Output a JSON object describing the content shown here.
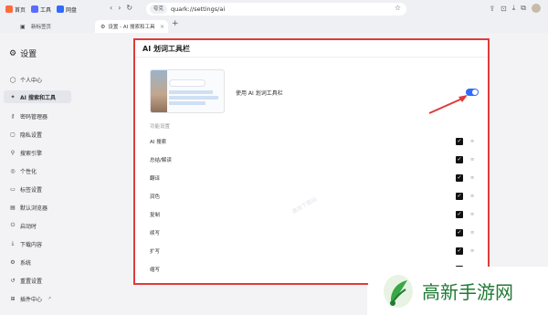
{
  "bookmarks": [
    {
      "label": "首页",
      "color": "#ff6a3c"
    },
    {
      "label": "工具",
      "color": "#5c6cff"
    },
    {
      "label": "网盘",
      "color": "#2f6bff"
    }
  ],
  "address": {
    "chip": "夸克",
    "url": "quark://settings/ai"
  },
  "tabs": [
    {
      "label": "新标签页"
    },
    {
      "label": "设置 - AI 搜索和工具"
    }
  ],
  "sidebar": {
    "title": "设置",
    "items": [
      {
        "label": "个人中心",
        "icon": "user-icon"
      },
      {
        "label": "AI 搜索和工具",
        "icon": "ai-spark-icon",
        "active": true
      },
      {
        "label": "密码管理器",
        "icon": "key-icon"
      },
      {
        "label": "隐私设置",
        "icon": "privacy-icon"
      },
      {
        "label": "搜索引擎",
        "icon": "search-icon"
      },
      {
        "label": "个性化",
        "icon": "palette-icon"
      },
      {
        "label": "标签设置",
        "icon": "tab-icon"
      },
      {
        "label": "默认浏览器",
        "icon": "browser-icon"
      },
      {
        "label": "启动时",
        "icon": "power-icon"
      },
      {
        "label": "下载内容",
        "icon": "download-icon"
      },
      {
        "label": "系统",
        "icon": "system-icon"
      },
      {
        "label": "重置设置",
        "icon": "reset-icon"
      },
      {
        "label": "插件中心",
        "icon": "plugin-icon"
      }
    ]
  },
  "main": {
    "title": "AI 划词工具栏",
    "toggle_label": "使用 AI 划词工具栏",
    "toggle_on": true,
    "section_label": "功能设置",
    "features": [
      {
        "label": "AI 搜索",
        "checked": true
      },
      {
        "label": "总结/解读",
        "checked": true
      },
      {
        "label": "翻译",
        "checked": true
      },
      {
        "label": "润色",
        "checked": true
      },
      {
        "label": "复制",
        "checked": true
      },
      {
        "label": "续写",
        "checked": true
      },
      {
        "label": "扩写",
        "checked": true
      },
      {
        "label": "缩写",
        "checked": true
      }
    ],
    "watermark": "高效下载站"
  },
  "logo_text": "高新手游网",
  "colors": {
    "accent": "#2f6bff",
    "highlight_border": "#e03a3a",
    "logo_green": "#1f7a34"
  }
}
